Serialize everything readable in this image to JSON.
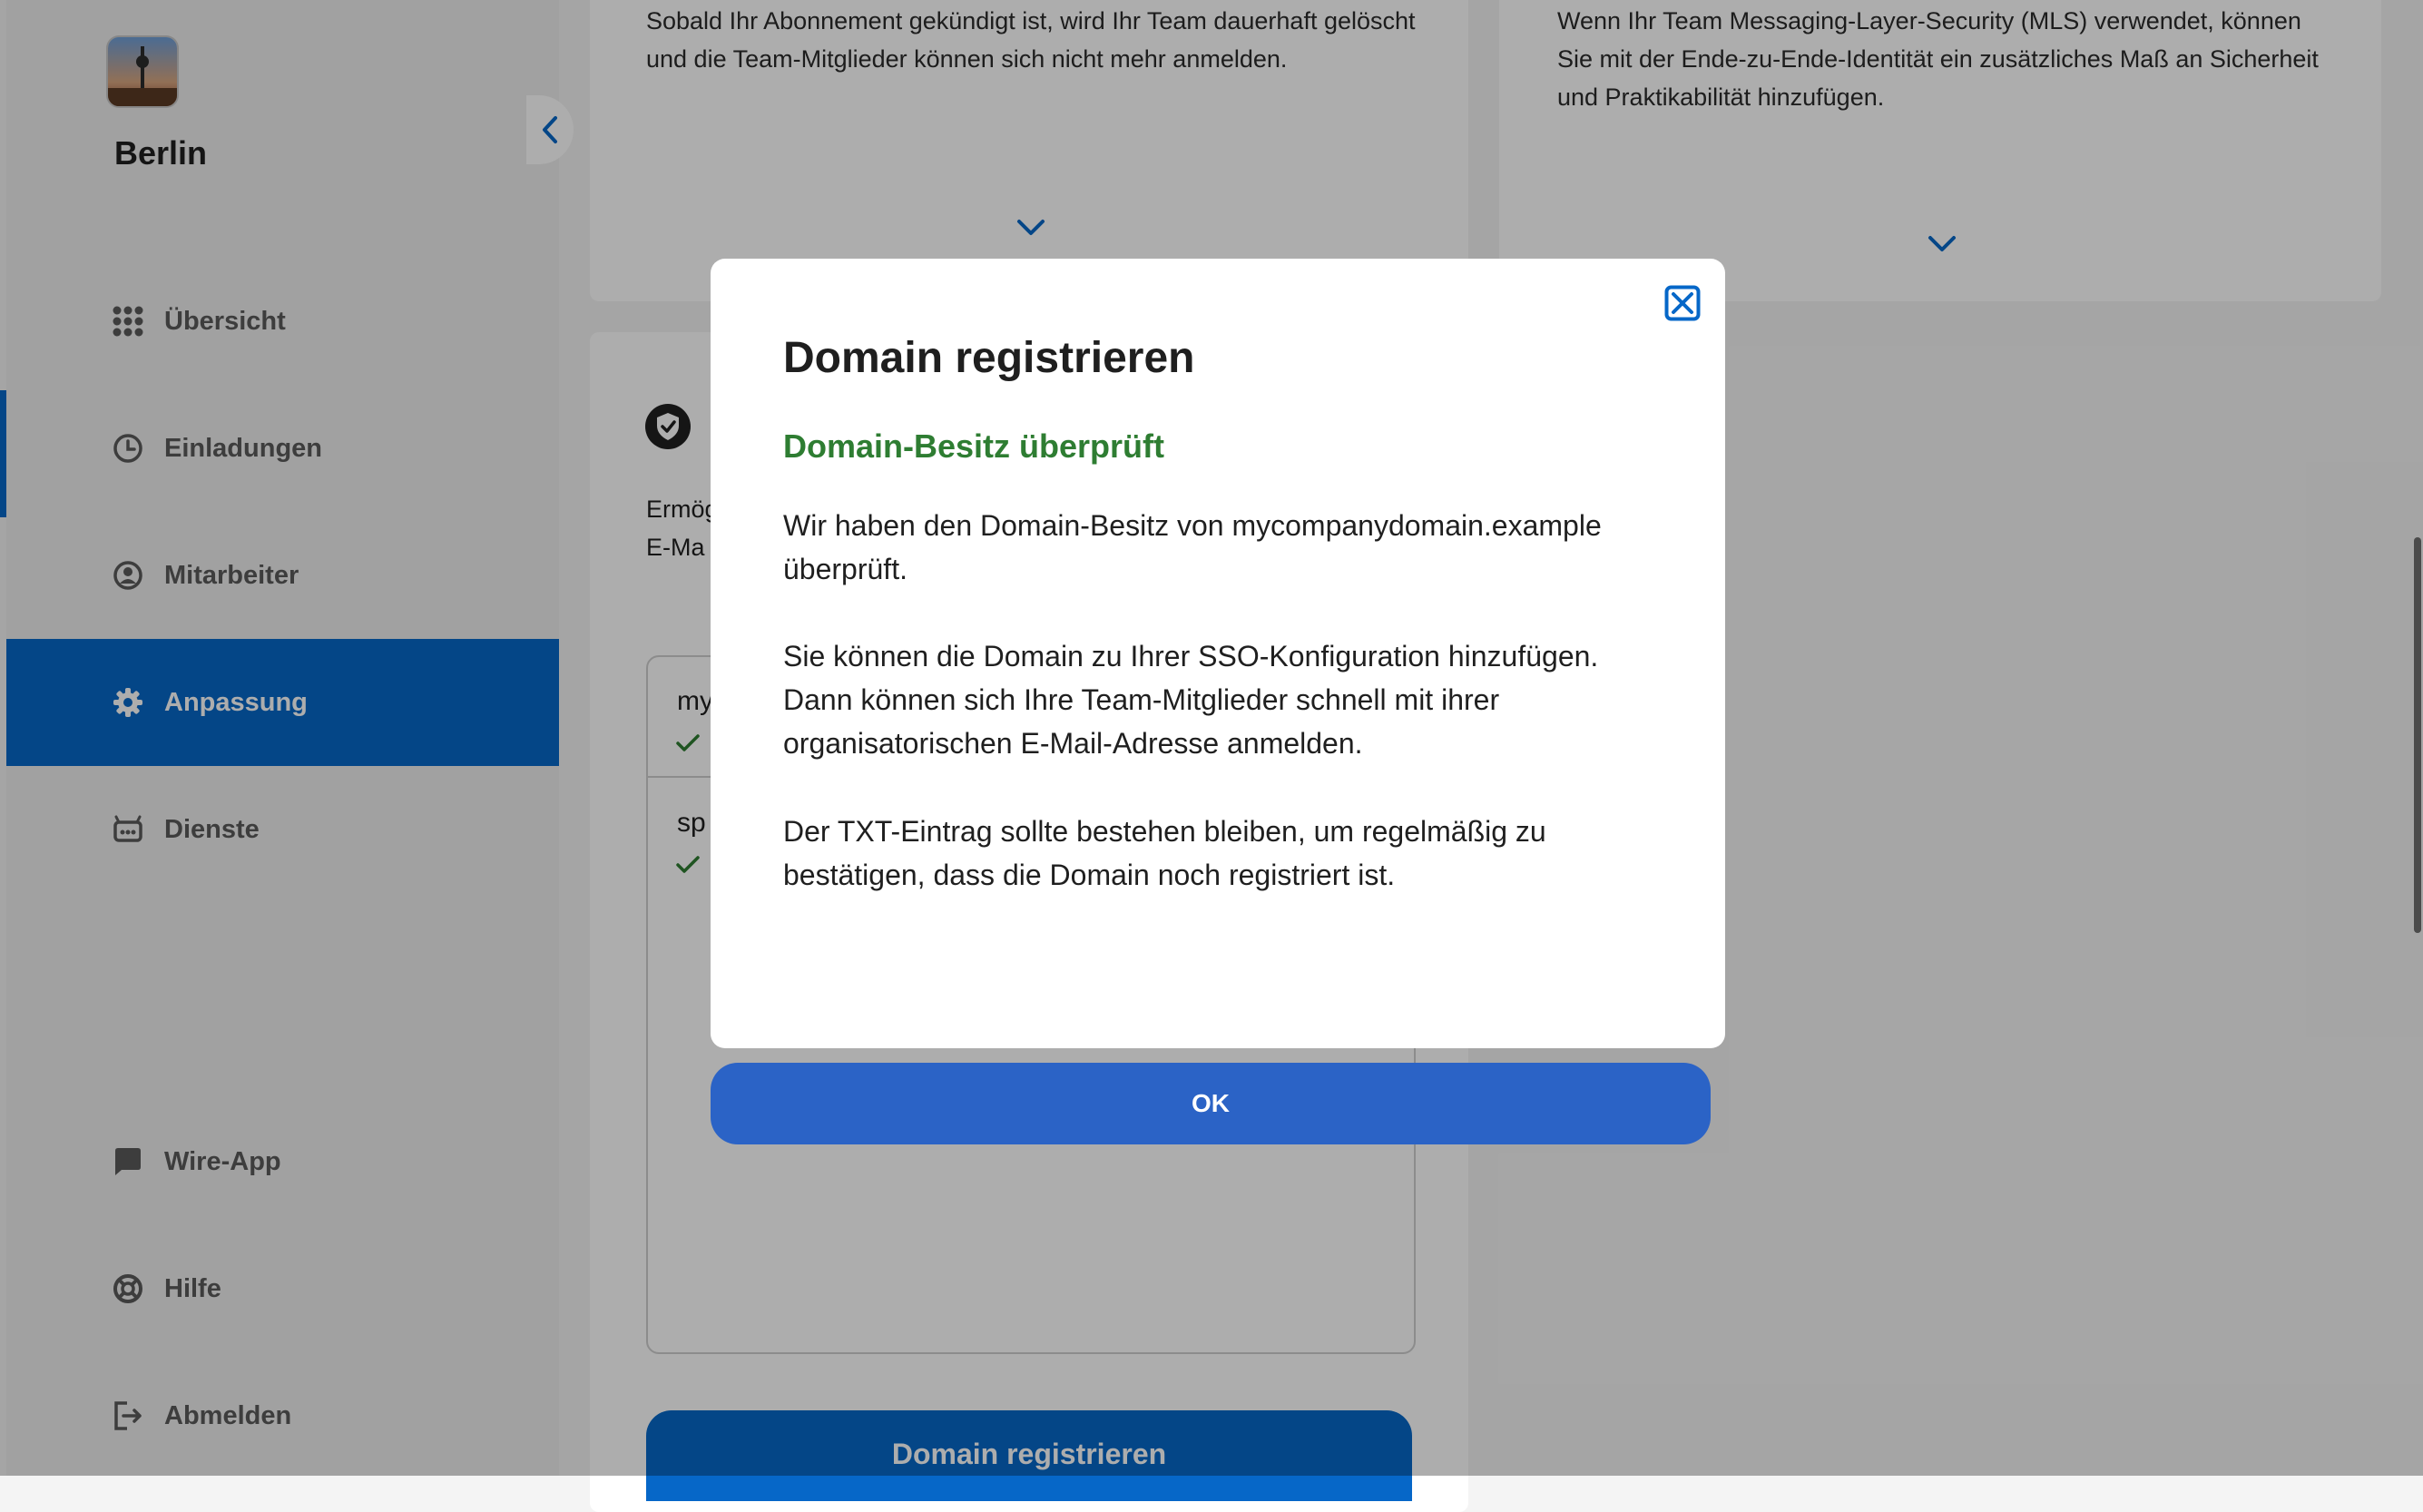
{
  "sidebar": {
    "team_name": "Berlin",
    "items": [
      {
        "label": "Übersicht",
        "icon": "grid-icon"
      },
      {
        "label": "Einladungen",
        "icon": "clock-icon"
      },
      {
        "label": "Mitarbeiter",
        "icon": "user-circle-icon"
      },
      {
        "label": "Anpassung",
        "icon": "gear-icon",
        "active": true
      },
      {
        "label": "Dienste",
        "icon": "robot-icon"
      }
    ],
    "bottom_items": [
      {
        "label": "Wire-App",
        "icon": "chat-icon"
      },
      {
        "label": "Hilfe",
        "icon": "lifebuoy-icon"
      },
      {
        "label": "Abmelden",
        "icon": "logout-icon"
      }
    ]
  },
  "main": {
    "card_left_text": "Sobald Ihr Abonnement gekündigt ist, wird Ihr Team dauerhaft gelöscht und die Team-Mitglieder können sich nicht mehr anmelden.",
    "card_right_text": "Wenn Ihr Team Messaging-Layer-Security (MLS) verwendet, können Sie mit der Ende-zu-Ende-Identität ein zusätzliches Maß an Sicherheit und Praktikabilität hinzufügen.",
    "domain_card_fragment_1": "Ermög",
    "domain_card_fragment_2": "E-Ma",
    "domain_item_1": "my",
    "domain_item_2": "sp",
    "register_button": "Domain registrieren"
  },
  "modal": {
    "title": "Domain registrieren",
    "subtitle": "Domain-Besitz überprüft",
    "paragraph_1": "Wir haben den Domain-Besitz von mycompanydomain.example überprüft.",
    "paragraph_2": "Sie können die Domain zu Ihrer SSO-Konfiguration hinzufügen. Dann können sich Ihre Team-Mitglieder schnell mit ihrer organisatorischen E-Mail-Adresse anmelden.",
    "paragraph_3": "Der TXT-Eintrag sollte bestehen bleiben, um regelmäßig zu bestätigen, dass die Domain noch registriert ist.",
    "ok_label": "OK",
    "close_icon": "close-icon"
  },
  "colors": {
    "accent": "#0667c8",
    "success": "#2e7d32",
    "modal_button": "#2b63c6"
  }
}
